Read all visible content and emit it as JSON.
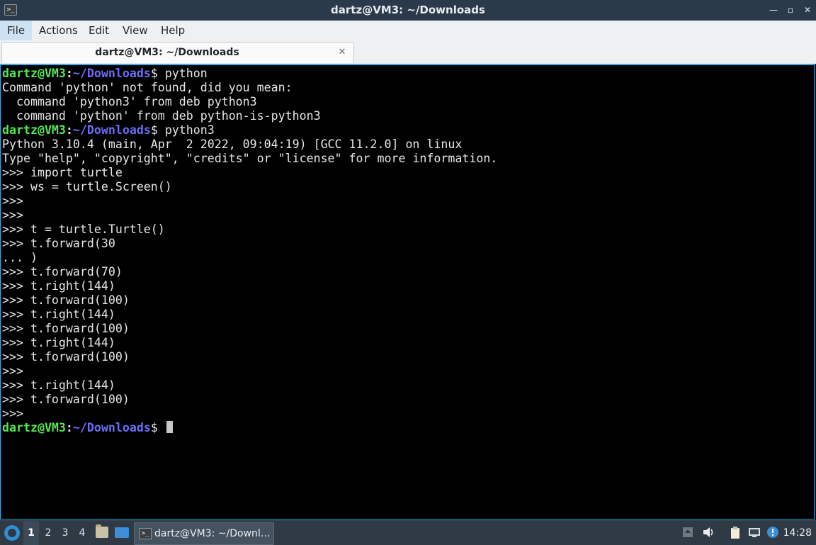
{
  "window": {
    "title": "dartz@VM3: ~/Downloads",
    "app_icon": ">_",
    "controls": [
      {
        "name": "minimize-button",
        "icon": "minimize-icon",
        "glyph": "—"
      },
      {
        "name": "restore-button",
        "icon": "restore-icon",
        "glyph": "▫"
      },
      {
        "name": "close-button",
        "icon": "close-icon",
        "glyph": "✕"
      }
    ]
  },
  "menu": {
    "file": "File",
    "actions": "Actions",
    "edit": "Edit",
    "view": "View",
    "help": "Help"
  },
  "tab": {
    "label": "dartz@VM3: ~/Downloads",
    "close": "✕"
  },
  "terminal": {
    "user_host": "dartz@VM3",
    "path": "~/Downloads",
    "lines": [
      {
        "prompt": true,
        "cmd": " python"
      },
      {
        "text": "Command 'python' not found, did you mean:"
      },
      {
        "text": "  command 'python3' from deb python3"
      },
      {
        "text": "  command 'python' from deb python-is-python3"
      },
      {
        "prompt": true,
        "cmd": " python3"
      },
      {
        "text": "Python 3.10.4 (main, Apr  2 2022, 09:04:19) [GCC 11.2.0] on linux"
      },
      {
        "text": "Type \"help\", \"copyright\", \"credits\" or \"license\" for more information."
      },
      {
        "text": ">>> import turtle"
      },
      {
        "text": ">>> ws = turtle.Screen()"
      },
      {
        "text": ">>> "
      },
      {
        "text": ">>> "
      },
      {
        "text": ">>> t = turtle.Turtle()"
      },
      {
        "text": ">>> t.forward(30"
      },
      {
        "text": "... )"
      },
      {
        "text": ">>> t.forward(70)"
      },
      {
        "text": ">>> t.right(144)"
      },
      {
        "text": ">>> t.forward(100)"
      },
      {
        "text": ">>> t.right(144)"
      },
      {
        "text": ">>> t.forward(100)"
      },
      {
        "text": ">>> t.right(144)"
      },
      {
        "text": ">>> t.forward(100)"
      },
      {
        "text": ">>> "
      },
      {
        "text": ">>> t.right(144)"
      },
      {
        "text": ">>> t.forward(100)"
      },
      {
        "text": ">>> "
      },
      {
        "prompt": true,
        "cmd": " ",
        "cursor": true
      }
    ]
  },
  "taskbar": {
    "desktops": [
      "1",
      "2",
      "3",
      "4"
    ],
    "active_desktop": "1",
    "task_label": "dartz@VM3: ~/Downl…",
    "clock": "14:28",
    "tray_icons": [
      "network-upload-icon",
      "volume-icon",
      "clipboard-icon",
      "network-icon",
      "notification-icon"
    ]
  },
  "colors": {
    "titlebar": "#2b3a4a",
    "prompt_user": "#54e854",
    "prompt_path": "#6c6cf5",
    "focus_border": "#3daee9",
    "taskbar": "#2f3a44"
  }
}
